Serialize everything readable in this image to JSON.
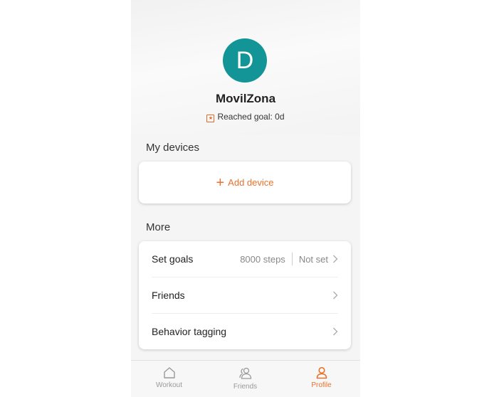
{
  "profile": {
    "avatar_letter": "D",
    "username": "MovilZona",
    "goal_text": "Reached goal: 0d",
    "avatar_color": "#139597"
  },
  "devices": {
    "section_title": "My devices",
    "add_label": "Add device"
  },
  "more": {
    "section_title": "More",
    "rows": [
      {
        "label": "Set goals",
        "value": "8000 steps",
        "status": "Not set"
      },
      {
        "label": "Friends"
      },
      {
        "label": "Behavior tagging"
      }
    ]
  },
  "tabs": [
    {
      "label": "Workout",
      "icon": "home-icon",
      "active": false
    },
    {
      "label": "Friends",
      "icon": "friends-icon",
      "active": false
    },
    {
      "label": "Profile",
      "icon": "profile-icon",
      "active": true
    }
  ],
  "colors": {
    "accent": "#e8722c",
    "inactive": "#999999"
  }
}
